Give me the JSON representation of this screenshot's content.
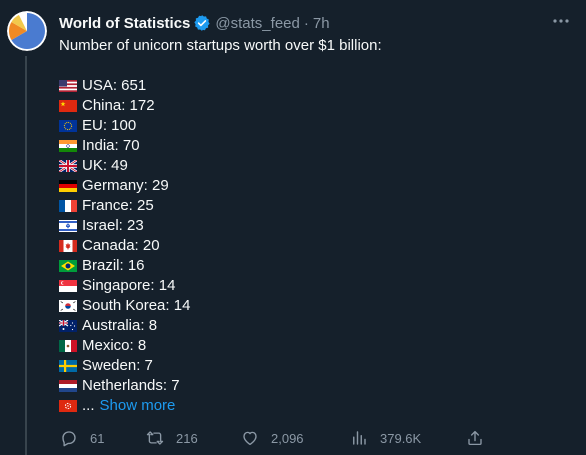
{
  "author": {
    "name": "World of Statistics",
    "handle": "@stats_feed",
    "separator": "·",
    "time": "7h",
    "verified_color": "#1d9bf0"
  },
  "tweet": {
    "intro": "Number of unicorn startups worth over $1 billion:",
    "items": [
      {
        "flag": "us-flag",
        "text": "USA: 651"
      },
      {
        "flag": "cn-flag",
        "text": "China: 172"
      },
      {
        "flag": "eu-flag",
        "text": "EU: 100"
      },
      {
        "flag": "in-flag",
        "text": "India: 70"
      },
      {
        "flag": "gb-flag",
        "text": "UK: 49"
      },
      {
        "flag": "de-flag",
        "text": "Germany: 29"
      },
      {
        "flag": "fr-flag",
        "text": "France: 25"
      },
      {
        "flag": "il-flag",
        "text": "Israel: 23"
      },
      {
        "flag": "ca-flag",
        "text": "Canada: 20"
      },
      {
        "flag": "br-flag",
        "text": "Brazil: 16"
      },
      {
        "flag": "sg-flag",
        "text": "Singapore: 14"
      },
      {
        "flag": "kr-flag",
        "text": "South Korea: 14"
      },
      {
        "flag": "au-flag",
        "text": "Australia: 8"
      },
      {
        "flag": "mx-flag",
        "text": "Mexico: 8"
      },
      {
        "flag": "se-flag",
        "text": "Sweden: 7"
      },
      {
        "flag": "nl-flag",
        "text": "Netherlands: 7"
      }
    ],
    "truncated_flag": "hk-flag",
    "ellipsis": "...",
    "show_more": "Show more"
  },
  "actions": {
    "replies": "61",
    "retweets": "216",
    "likes": "2,096",
    "views": "379.6K"
  },
  "icons": {
    "more": "more-options-icon",
    "reply": "reply-icon",
    "retweet": "retweet-icon",
    "like": "heart-icon",
    "views": "views-icon",
    "share": "share-icon"
  },
  "colors": {
    "background": "#15202b",
    "text": "#f7f9f9",
    "muted": "#8b98a5",
    "link": "#1d9bf0"
  }
}
